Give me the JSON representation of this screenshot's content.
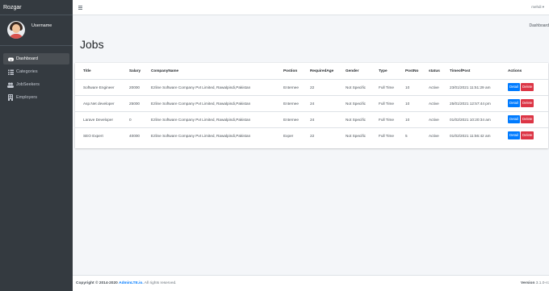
{
  "brand": {
    "name": "Rozgar"
  },
  "user": {
    "name": "Username"
  },
  "sidebar": {
    "items": [
      {
        "label": "Dashboard",
        "icon": "dashboard-icon",
        "active": true
      },
      {
        "label": "Categories",
        "icon": "list-icon",
        "active": false
      },
      {
        "label": "JobSeekers",
        "icon": "users-icon",
        "active": false
      },
      {
        "label": "Employers",
        "icon": "building-icon",
        "active": false
      }
    ]
  },
  "topbar": {
    "user_menu": "mehdi"
  },
  "header": {
    "breadcrumb": "Dashboard",
    "title": "Jobs"
  },
  "table": {
    "columns": [
      "Title",
      "Salary",
      "CompanyName",
      "Postion",
      "RequiredAge",
      "Gender",
      "Type",
      "PostNo",
      "status",
      "TimeofPost",
      "Actions"
    ],
    "rows": [
      [
        "Software Engineer",
        "20000",
        "Ezline Software Company Pvt Limited, Rawalpindi,Pakistan",
        "Enternee",
        "22",
        "Not Specific",
        "Full Time",
        "10",
        "Active",
        "23/01/2021 11:51:29 am"
      ],
      [
        "Asp.Net developer",
        "25000",
        "Ezline Software Company Pvt Limited, Rawalpindi,Pakistan",
        "Enternee",
        "24",
        "Not Specific",
        "Full Time",
        "10",
        "Active",
        "25/01/2021 12:57:44 pm"
      ],
      [
        "Larave Developer",
        "0",
        "Ezline Software Company Pvt Limited, Rawalpindi,Pakistan",
        "Enternee",
        "24",
        "Not Specific",
        "Full Time",
        "10",
        "Active",
        "01/02/2021 10:20:34 am"
      ],
      [
        "SEO Expert",
        "40000",
        "Ezline Software Company Pvt Limited, Rawalpindi,Pakistan",
        "Exper",
        "22",
        "Not Specific",
        "Full Time",
        "5",
        "Active",
        "01/02/2021 11:56:42 am"
      ]
    ],
    "detail_label": "Detail",
    "delete_label": "Delete"
  },
  "footer": {
    "copyright": "Copyright © 2014-2020",
    "link": "AdminLTE.io.",
    "rights": "All rights reserved.",
    "version_label": "Version",
    "version": "3.1.0-rc"
  },
  "colors": {
    "sidebar_bg": "#343a40",
    "primary": "#007bff",
    "danger": "#dc3545"
  }
}
